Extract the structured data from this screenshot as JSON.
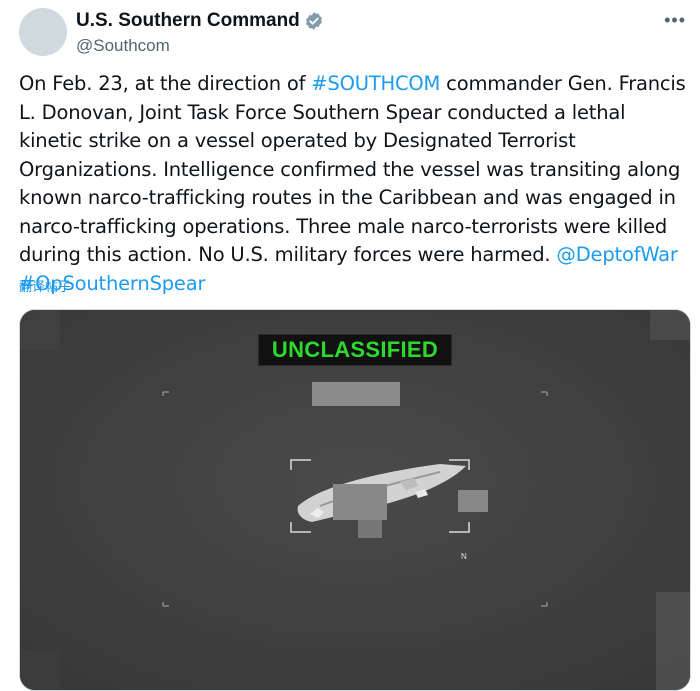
{
  "account": {
    "display_name": "U.S. Southern Command",
    "handle": "@Southcom"
  },
  "tweet": {
    "text_1": "On Feb. 23, at the direction of ",
    "hashtag_southcom": "#SOUTHCOM",
    "text_2": " commander Gen. Francis L. Donovan, Joint Task Force Southern Spear conducted a lethal kinetic strike on a vessel operated by Designated Terrorist Organizations. Intelligence confirmed the vessel was transiting along known narco-trafficking routes in the Caribbean and was engaged in narco-trafficking operations. Three male narco-terrorists were killed during this action. No U.S. military forces were harmed. ",
    "mention_deptofwar": "@DeptofWar",
    "text_3": " ",
    "hashtag_opsouthernspear": "#OpSouthernSpear",
    "translate_label": "翻译帖子"
  },
  "media": {
    "classification_banner": "UNCLASSIFIED",
    "north_marker": "N"
  },
  "icons": {
    "verified": "verified-badge-icon",
    "more": "more-options-icon"
  },
  "colors": {
    "link": "#1d9bf0",
    "secondary_text": "#536471",
    "banner_text": "#2fd82f"
  }
}
